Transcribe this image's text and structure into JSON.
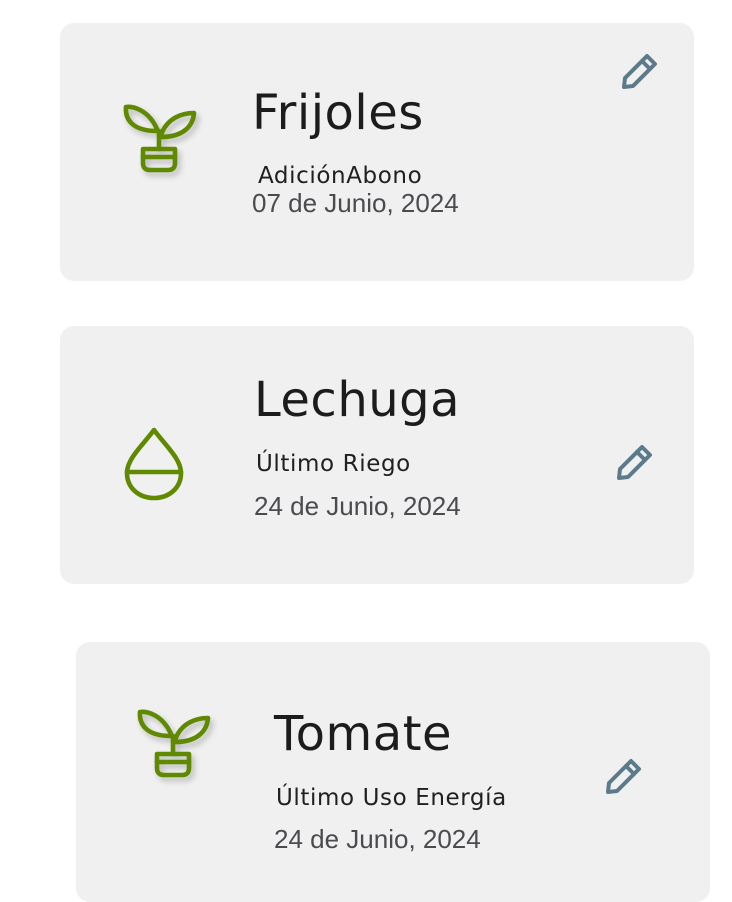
{
  "colors": {
    "card_background": "#f0f0f1",
    "icon_green": "#5f8a00",
    "edit_icon": "#5c7b8a",
    "title_text": "#1c1c1c",
    "date_text": "#4a4a4f"
  },
  "cards": [
    {
      "icon": "sprout-in-pot-icon",
      "title": "Frijoles",
      "subtitle": "AdiciónAbono",
      "date": "07 de Junio, 2024",
      "action_icon": "pencil-icon"
    },
    {
      "icon": "water-drop-icon",
      "title": "Lechuga",
      "subtitle": "Último Riego",
      "date": "24 de Junio, 2024",
      "action_icon": "pencil-icon"
    },
    {
      "icon": "sprout-in-pot-icon",
      "title": "Tomate",
      "subtitle": "Último Uso Energía",
      "date": "24 de Junio, 2024",
      "action_icon": "pencil-icon"
    }
  ]
}
